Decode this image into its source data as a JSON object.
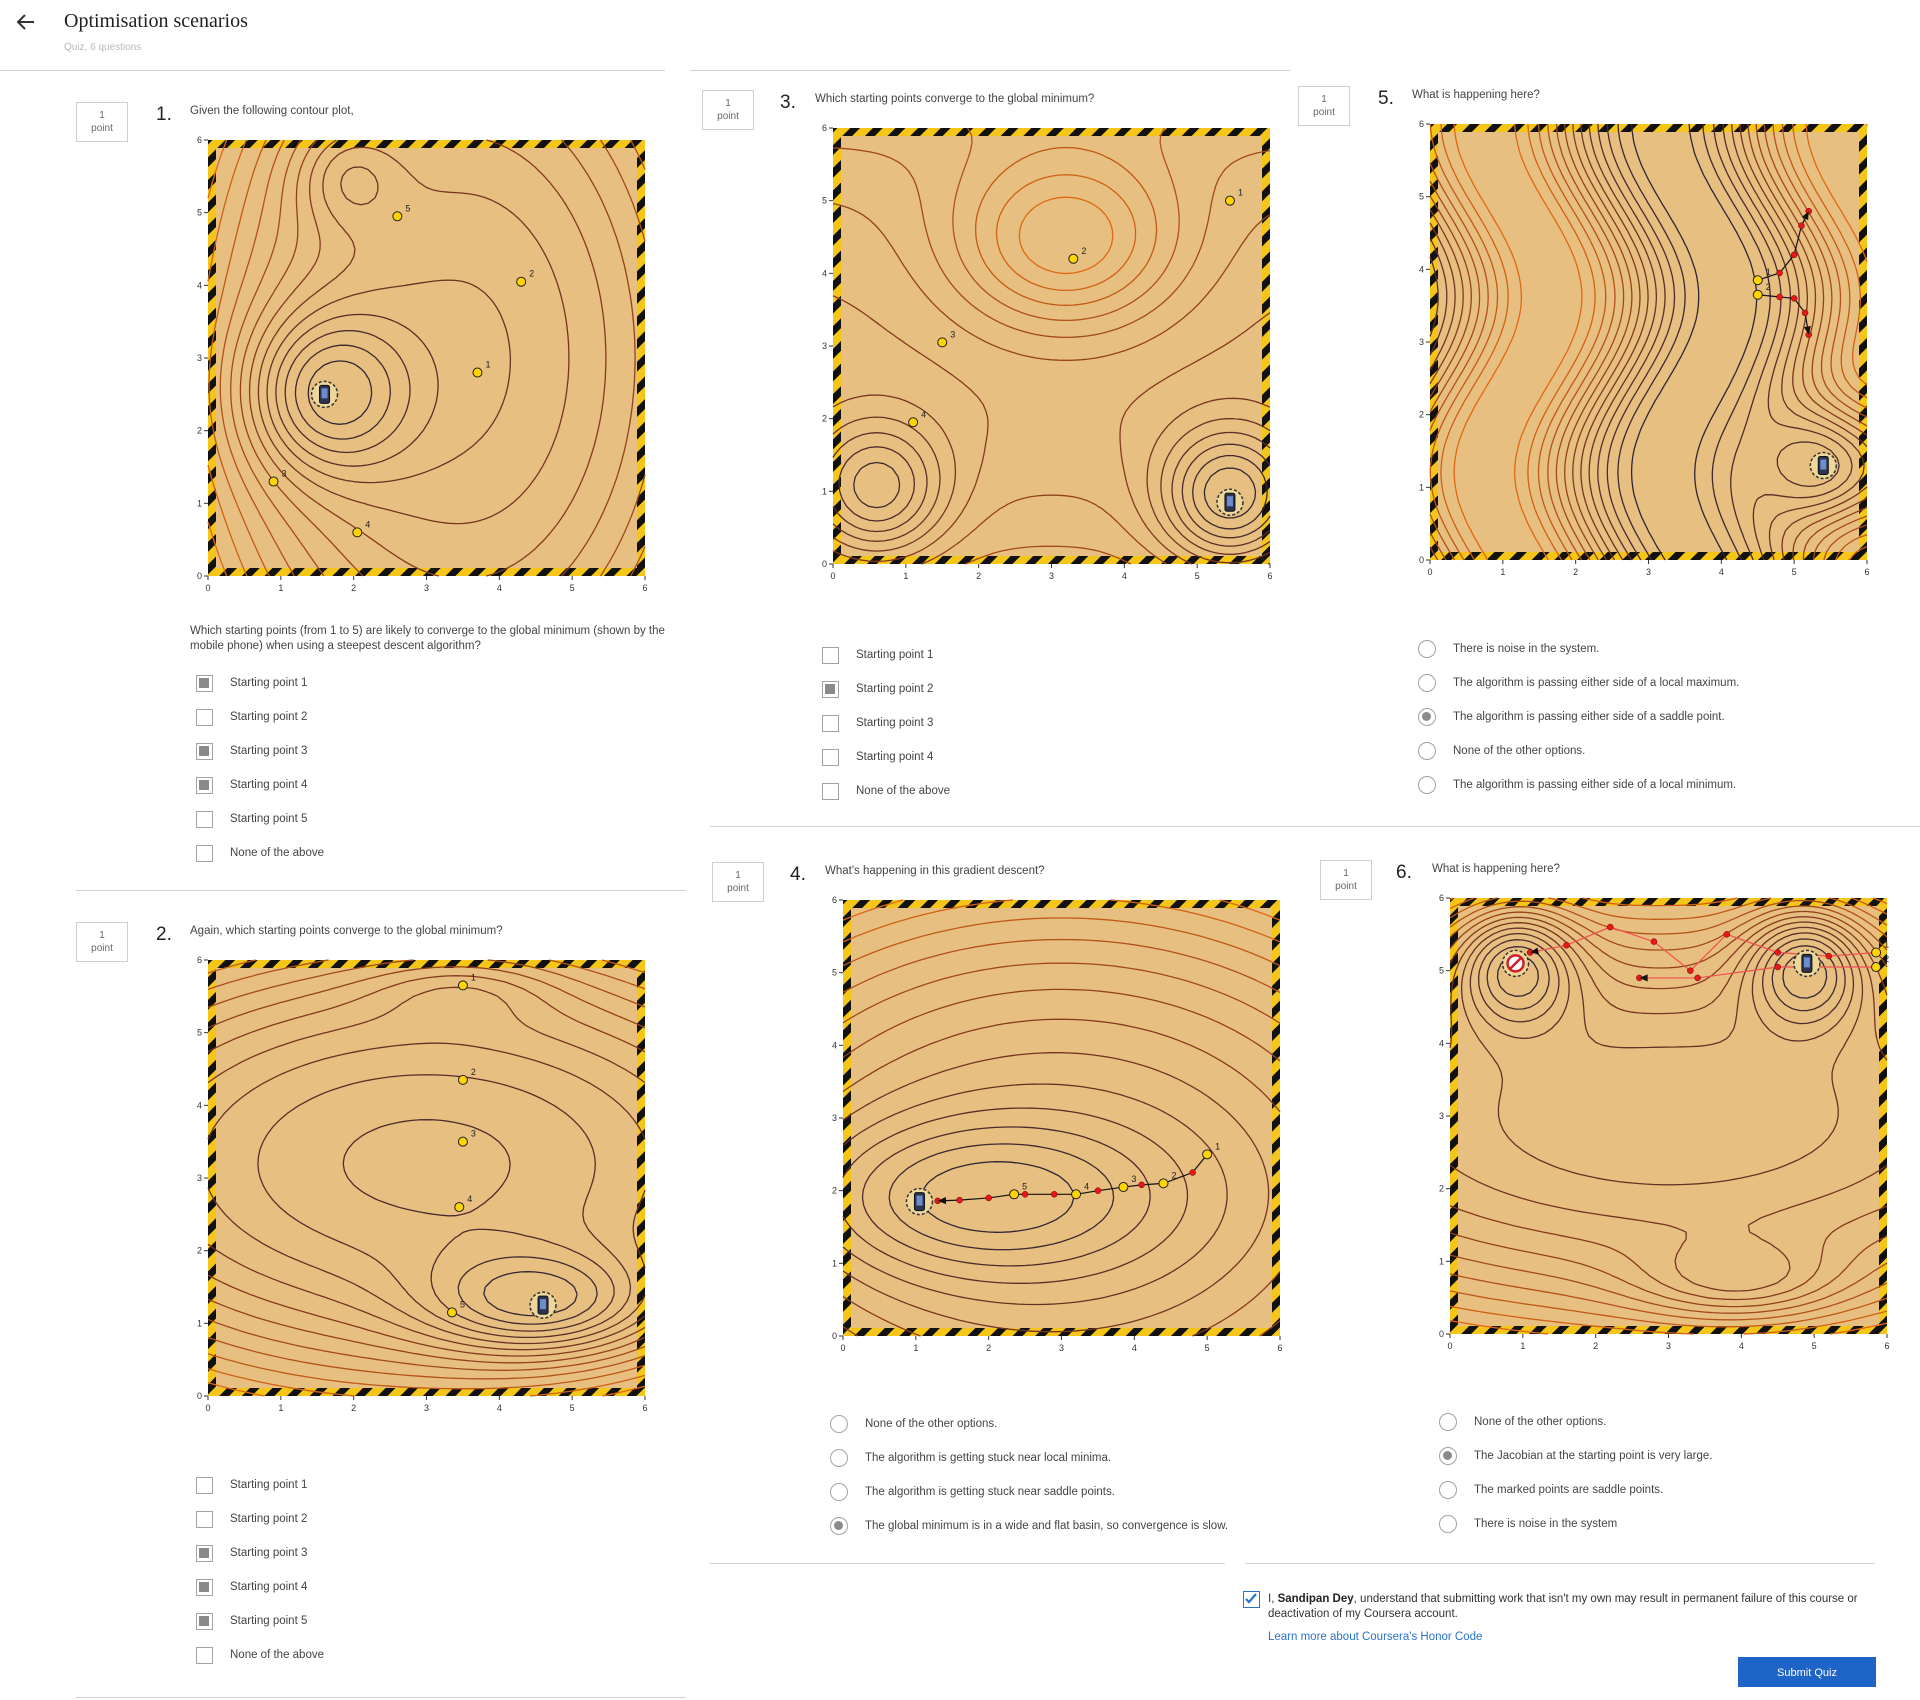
{
  "header": {
    "back_icon": "arrow-left-icon",
    "title": "Optimisation scenarios",
    "subtitle": "Quiz, 6 questions"
  },
  "colors": {
    "sand": "#e7bf80",
    "tape_yellow": "#f5c518",
    "tape_black": "#111111",
    "contour_dark": "#22223a",
    "contour_mid": "#7a3520",
    "contour_light": "#f07010",
    "marker_yellow": "#ffd400",
    "arrow_red": "#e81818",
    "submit_blue": "#1e63c6",
    "link_blue": "#2a73cc"
  },
  "ticks": [
    "0",
    "1",
    "2",
    "3",
    "4",
    "5",
    "6"
  ],
  "questions": [
    {
      "points": "1",
      "points_label": "point",
      "number": "1.",
      "prompt": "Given the following contour plot,",
      "followup": "Which starting points (from 1 to 5) are likely to converge to the global minimum (shown by the mobile phone) when using a steepest descent algorithm?",
      "plot_markers": [
        {
          "label": "1",
          "x": 3.7,
          "y": 2.8
        },
        {
          "label": "2",
          "x": 4.3,
          "y": 4.05
        },
        {
          "label": "3",
          "x": 0.9,
          "y": 1.3
        },
        {
          "label": "4",
          "x": 2.05,
          "y": 0.6
        },
        {
          "label": "5",
          "x": 2.6,
          "y": 4.95
        }
      ],
      "global_min": {
        "x": 1.6,
        "y": 2.5
      },
      "options": [
        {
          "label": "Starting point 1",
          "selected": true
        },
        {
          "label": "Starting point 2",
          "selected": false
        },
        {
          "label": "Starting point 3",
          "selected": true
        },
        {
          "label": "Starting point 4",
          "selected": true
        },
        {
          "label": "Starting point 5",
          "selected": false
        },
        {
          "label": "None of the above",
          "selected": false
        }
      ]
    },
    {
      "points": "1",
      "points_label": "point",
      "number": "2.",
      "prompt": "Again, which starting points converge to the global minimum?",
      "plot_markers": [
        {
          "label": "1",
          "x": 3.5,
          "y": 5.65
        },
        {
          "label": "2",
          "x": 3.5,
          "y": 4.35
        },
        {
          "label": "3",
          "x": 3.5,
          "y": 3.5
        },
        {
          "label": "4",
          "x": 3.45,
          "y": 2.6
        },
        {
          "label": "5",
          "x": 3.35,
          "y": 1.15
        }
      ],
      "global_min": {
        "x": 4.6,
        "y": 1.25
      },
      "options": [
        {
          "label": "Starting point 1",
          "selected": false
        },
        {
          "label": "Starting point 2",
          "selected": false
        },
        {
          "label": "Starting point 3",
          "selected": true
        },
        {
          "label": "Starting point 4",
          "selected": true
        },
        {
          "label": "Starting point 5",
          "selected": true
        },
        {
          "label": "None of the above",
          "selected": false
        }
      ]
    },
    {
      "points": "1",
      "points_label": "point",
      "number": "3.",
      "prompt": "Which starting points converge to the global minimum?",
      "plot_markers": [
        {
          "label": "1",
          "x": 5.45,
          "y": 5.0
        },
        {
          "label": "2",
          "x": 3.3,
          "y": 4.2
        },
        {
          "label": "3",
          "x": 1.5,
          "y": 3.05
        },
        {
          "label": "4",
          "x": 1.1,
          "y": 1.95
        }
      ],
      "global_min": {
        "x": 5.45,
        "y": 0.85
      },
      "options": [
        {
          "label": "Starting point 1",
          "selected": false
        },
        {
          "label": "Starting point 2",
          "selected": true
        },
        {
          "label": "Starting point 3",
          "selected": false
        },
        {
          "label": "Starting point 4",
          "selected": false
        },
        {
          "label": "None of the above",
          "selected": false
        }
      ]
    },
    {
      "points": "1",
      "points_label": "point",
      "number": "4.",
      "prompt": "What's happening in this gradient descent?",
      "plot_markers": [
        {
          "label": "1",
          "x": 5.0,
          "y": 2.5
        },
        {
          "label": "2",
          "x": 4.4,
          "y": 2.1
        },
        {
          "label": "3",
          "x": 3.85,
          "y": 2.05
        },
        {
          "label": "4",
          "x": 3.2,
          "y": 1.95
        },
        {
          "label": "5",
          "x": 2.35,
          "y": 1.95
        }
      ],
      "global_min": {
        "x": 1.05,
        "y": 1.85
      },
      "options": [
        {
          "label": "None of the other options.",
          "selected": false
        },
        {
          "label": "The algorithm is getting stuck near local minima.",
          "selected": false
        },
        {
          "label": "The algorithm is getting stuck near saddle points.",
          "selected": false
        },
        {
          "label": "The global minimum is in a wide and flat basin, so convergence is slow.",
          "selected": true
        }
      ]
    },
    {
      "points": "1",
      "points_label": "point",
      "number": "5.",
      "prompt": "What is happening here?",
      "plot_markers": [
        {
          "label": "1",
          "x": 4.5,
          "y": 3.85
        },
        {
          "label": "2",
          "x": 4.5,
          "y": 3.65
        }
      ],
      "global_min": {
        "x": 5.4,
        "y": 1.3
      },
      "options": [
        {
          "label": "There is noise in the system.",
          "selected": false
        },
        {
          "label": "The algorithm is passing either side of a local maximum.",
          "selected": false
        },
        {
          "label": "The algorithm is passing either side of a saddle point.",
          "selected": true
        },
        {
          "label": "None of the other options.",
          "selected": false
        },
        {
          "label": "The algorithm is passing either side of a local minimum.",
          "selected": false
        }
      ]
    },
    {
      "points": "1",
      "points_label": "point",
      "number": "6.",
      "prompt": "What is happening here?",
      "plot_markers": [
        {
          "label": "1",
          "x": 5.85,
          "y": 5.25
        },
        {
          "label": "2",
          "x": 5.85,
          "y": 5.05
        }
      ],
      "global_min": {
        "x": 4.9,
        "y": 5.1
      },
      "no_entry_point": {
        "x": 0.9,
        "y": 5.1
      },
      "options": [
        {
          "label": "None of the other options.",
          "selected": false
        },
        {
          "label": "The Jacobian at the starting point is very large.",
          "selected": true
        },
        {
          "label": "The marked points are saddle points.",
          "selected": false
        },
        {
          "label": "There is noise in the system",
          "selected": false
        }
      ]
    }
  ],
  "honor": {
    "checked": true,
    "prefix": "I, ",
    "name": "Sandipan Dey",
    "text": ", understand that submitting work that isn't my own may result in permanent failure of this course or deactivation of my Coursera account.",
    "link": "Learn more about Coursera's Honor Code"
  },
  "submit_label": "Submit Quiz"
}
